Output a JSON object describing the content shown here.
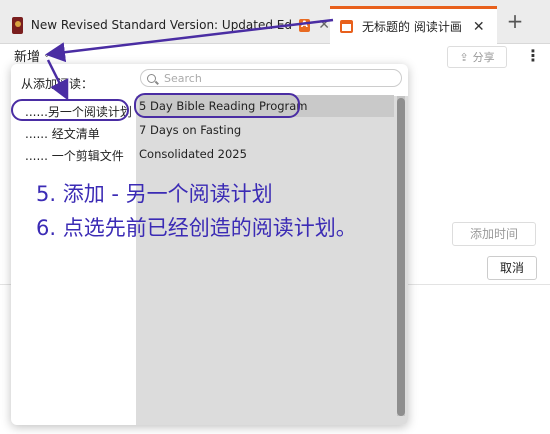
{
  "tabs": [
    {
      "title": "New Revised Standard Version: Updated Edition",
      "badge": "A",
      "close": "✕"
    },
    {
      "title": "无标题的 阅读计画",
      "close": "✕"
    }
  ],
  "new_tab": "+",
  "toolbar": {
    "new_label": "新增",
    "share_label": "分享",
    "more_icon": "⋮"
  },
  "main": {
    "add_time_label": "添加时间",
    "cancel_label": "取消",
    "colon": ":"
  },
  "popup": {
    "heading": "从添加阅读：",
    "options": [
      "......另一个阅读计划",
      "...... 经文清单",
      "...... 一个剪辑文件"
    ],
    "search_placeholder": "Search",
    "plans": [
      "5 Day Bible Reading Program",
      "7 Days on Fasting",
      "Consolidated 2025"
    ]
  },
  "annotation": {
    "step5": "5. 添加 - 另一个阅读计划",
    "step6": "6. 点选先前已经创造的阅读计划。"
  },
  "colors": {
    "accent": "#e8601c",
    "annotation": "#3b2bb5",
    "link": "#4b5bd6"
  }
}
